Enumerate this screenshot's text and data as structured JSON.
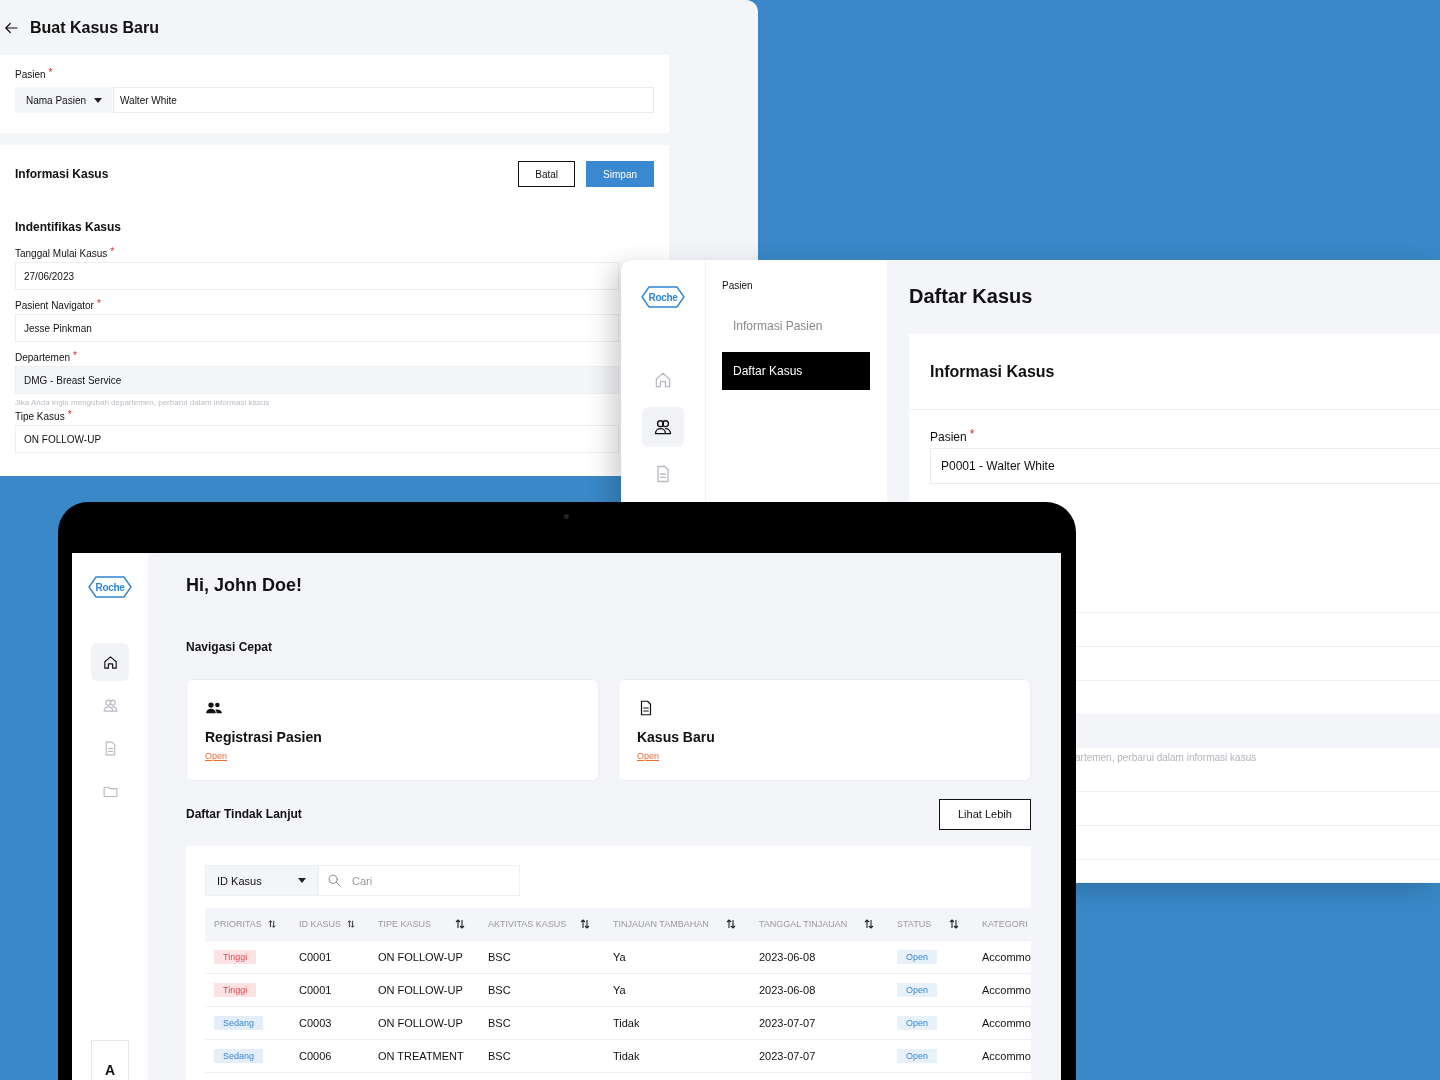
{
  "form_window": {
    "title": "Buat Kasus Baru",
    "patient": {
      "label": "Pasien",
      "required_mark": "*",
      "selector": "Nama Pasien",
      "value": "Walter White"
    },
    "section_title": "Informasi Kasus",
    "buttons": [
      {
        "label": "Batal",
        "kind": "outline"
      },
      {
        "label": "Simpan",
        "kind": "primary"
      }
    ],
    "subsection": "Indentifikas Kasus",
    "fields": [
      {
        "label": "Tanggal Mulai Kasus",
        "required_mark": "*",
        "value": "27/06/2023",
        "disabled": false
      },
      {
        "label": "Pasient Navigator",
        "required_mark": "*",
        "value": "Jesse Pinkman",
        "disabled": false
      },
      {
        "label": "Departemen",
        "required_mark": "*",
        "value": "DMG - Breast Service",
        "disabled": true,
        "hint": "Jika Anda ingin mengubah departemen, perbarui dalam informasi kasus"
      },
      {
        "label": "Tipe Kasus",
        "required_mark": "*",
        "value": "ON FOLLOW-UP",
        "disabled": false
      }
    ]
  },
  "case_window": {
    "logo": "Roche",
    "rail": [
      {
        "kind": "home",
        "selected": false
      },
      {
        "kind": "people",
        "selected": true
      },
      {
        "kind": "document",
        "selected": false
      }
    ],
    "nav_heading": "Pasien",
    "nav_items": [
      {
        "label": "Informasi Pasien",
        "selected": false
      },
      {
        "label": "Daftar Kasus",
        "selected": true
      }
    ],
    "title": "Daftar Kasus",
    "card_title": "Informasi Kasus",
    "patient": {
      "label": "Pasien",
      "required_mark": "*",
      "value": "P0001 - Walter White"
    },
    "hint": "artemen, perbarui dalam informasi kasus"
  },
  "tablet": {
    "logo": "Roche",
    "rail": [
      {
        "kind": "home",
        "selected": true
      },
      {
        "kind": "people",
        "selected": false
      },
      {
        "kind": "document",
        "selected": false
      },
      {
        "kind": "folder",
        "selected": false
      }
    ],
    "avatar": "A",
    "greeting": "Hi, John Doe!",
    "quick_nav": {
      "title": "Navigasi Cepat",
      "cards": [
        {
          "kind": "people",
          "title": "Registrasi Pasien",
          "link": "Open"
        },
        {
          "kind": "document",
          "title": "Kasus Baru",
          "link": "Open"
        }
      ]
    },
    "followup": {
      "title": "Daftar Tindak Lanjut",
      "button": "Lihat Lebih",
      "filter": "ID Kasus",
      "search_placeholder": "Cari",
      "columns": [
        {
          "label": "PRIORITAS",
          "sortable": true
        },
        {
          "label": "ID KASUS",
          "sortable": true
        },
        {
          "label": "TIPE KASUS",
          "sortable": true
        },
        {
          "label": "AKTIVITAS KASUS",
          "sortable": true
        },
        {
          "label": "TINJAUAN TAMBAHAN",
          "sortable": true
        },
        {
          "label": "TANGGAL TINJAUAN",
          "sortable": true
        },
        {
          "label": "STATUS",
          "sortable": true
        },
        {
          "label": "KATEGORI",
          "sortable": false
        }
      ],
      "rows": [
        {
          "cells": [
            {
              "label": "Tinggi",
              "kind": "high"
            },
            "C0001",
            "ON FOLLOW-UP",
            "BSC",
            "Ya",
            "2023-06-08",
            {
              "label": "Open",
              "kind": "status"
            },
            "Accommo"
          ]
        },
        {
          "cells": [
            {
              "label": "Tinggi",
              "kind": "high"
            },
            "C0001",
            "ON FOLLOW-UP",
            "BSC",
            "Ya",
            "2023-06-08",
            {
              "label": "Open",
              "kind": "status"
            },
            "Accommo"
          ]
        },
        {
          "cells": [
            {
              "label": "Sedang",
              "kind": "medium"
            },
            "C0003",
            "ON FOLLOW-UP",
            "BSC",
            "Tidak",
            "2023-07-07",
            {
              "label": "Open",
              "kind": "status"
            },
            "Accommo"
          ]
        },
        {
          "cells": [
            {
              "label": "Sedang",
              "kind": "medium"
            },
            "C0006",
            "ON TREATMENT",
            "BSC",
            "Tidak",
            "2023-07-07",
            {
              "label": "Open",
              "kind": "status"
            },
            "Accommo"
          ]
        }
      ]
    }
  }
}
